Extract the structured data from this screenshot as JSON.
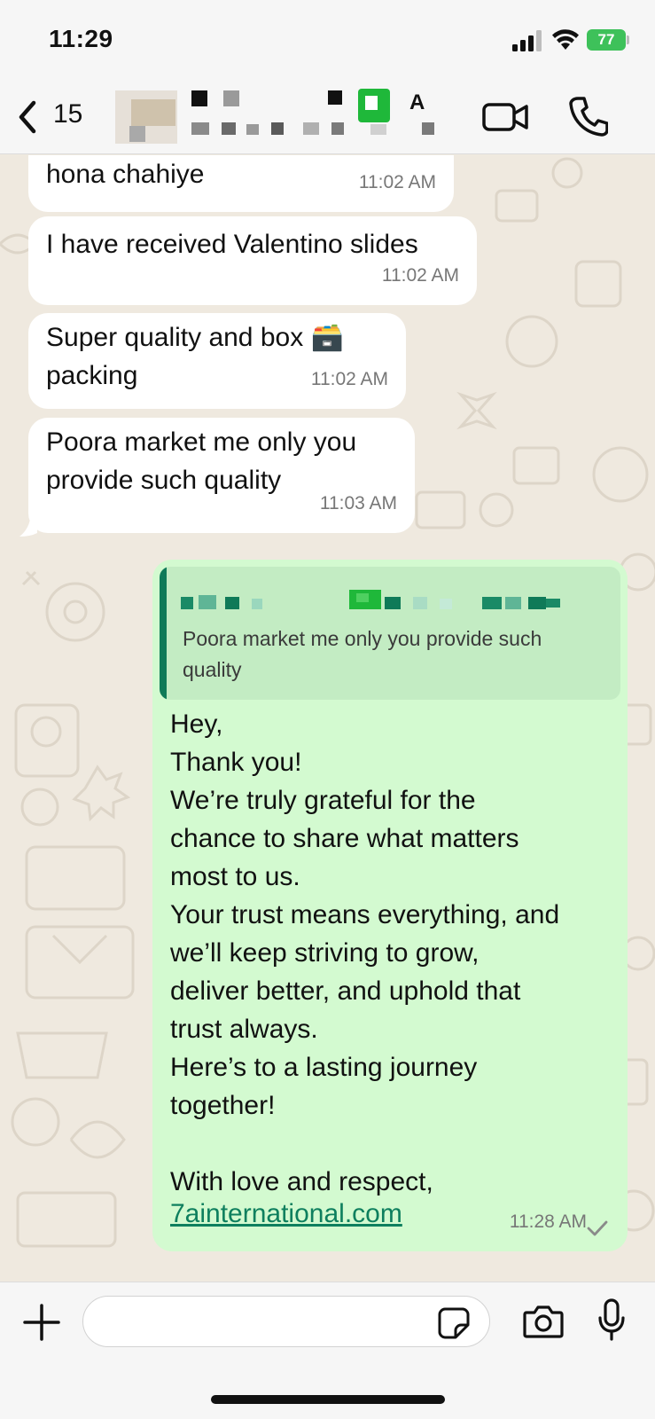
{
  "status_bar": {
    "time": "11:29",
    "battery": "77"
  },
  "header": {
    "unread_count": "15",
    "contact_name_visible": "A"
  },
  "messages": [
    {
      "direction": "in",
      "text": "hona chahiye",
      "time": "11:02 AM"
    },
    {
      "direction": "in",
      "text": "I have received Valentino slides",
      "time": "11:02 AM"
    },
    {
      "direction": "in",
      "text": "Super quality and box 🗃️\npacking",
      "time": "11:02 AM"
    },
    {
      "direction": "in",
      "text": "Poora market me only you\nprovide such quality",
      "time": "11:03 AM"
    }
  ],
  "outgoing": {
    "quote_text": "Poora market me only you provide such quality",
    "body": "Hey,\nThank you!\nWe’re truly grateful for the\nchance to share what matters\nmost to us.\nYour trust means everything, and\nwe’ll keep striving to grow,\ndeliver better, and uphold that\ntrust always.\nHere’s to a lasting journey\ntogether!\n\nWith love and respect,",
    "link": "7ainternational.com",
    "time": "11:28 AM",
    "status": "✓"
  },
  "input": {
    "placeholder": ""
  },
  "colors": {
    "outgoing_bubble": "#d3fad0",
    "incoming_bubble": "#ffffff",
    "accent": "#0e7f5e",
    "wallpaper": "#efe9df",
    "battery": "#3ec15a"
  }
}
